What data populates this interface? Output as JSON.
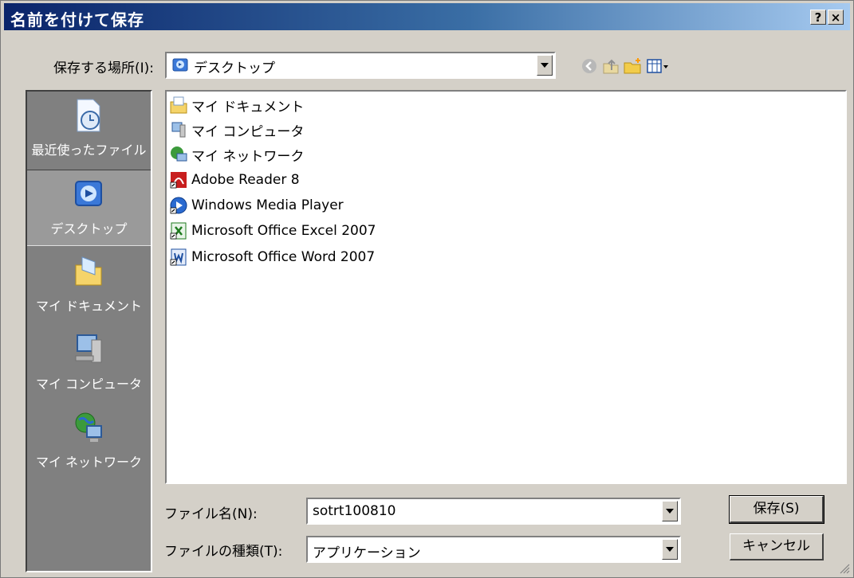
{
  "title": "名前を付けて保存",
  "titlebar_buttons": {
    "help": "?",
    "close": "×"
  },
  "save_in": {
    "label": "保存する場所(I):",
    "value": "デスクトップ"
  },
  "toolbar_icons": [
    "back-icon",
    "up-folder-icon",
    "new-folder-icon",
    "views-menu-icon"
  ],
  "places_bar": [
    {
      "label": "最近使ったファイル",
      "icon": "recent-files-icon",
      "selected": false
    },
    {
      "label": "デスクトップ",
      "icon": "desktop-icon",
      "selected": true
    },
    {
      "label": "マイ ドキュメント",
      "icon": "my-documents-icon",
      "selected": false
    },
    {
      "label": "マイ コンピュータ",
      "icon": "my-computer-icon",
      "selected": false
    },
    {
      "label": "マイ ネットワーク",
      "icon": "my-network-icon",
      "selected": false
    }
  ],
  "file_list": [
    {
      "name": "マイ ドキュメント",
      "icon": "documents-folder-icon"
    },
    {
      "name": "マイ コンピュータ",
      "icon": "computer-icon"
    },
    {
      "name": "マイ ネットワーク",
      "icon": "network-icon"
    },
    {
      "name": "Adobe Reader 8",
      "icon": "pdf-shortcut-icon"
    },
    {
      "name": "Windows Media Player",
      "icon": "media-player-icon"
    },
    {
      "name": "Microsoft Office Excel 2007",
      "icon": "excel-shortcut-icon"
    },
    {
      "name": "Microsoft Office Word 2007",
      "icon": "word-shortcut-icon"
    }
  ],
  "filename": {
    "label": "ファイル名(N):",
    "value": "sotrt100810"
  },
  "filetype": {
    "label": "ファイルの種類(T):",
    "value": "アプリケーション"
  },
  "buttons": {
    "save": "保存(S)",
    "cancel": "キャンセル"
  },
  "colors": {
    "titlebar_start": "#0a246a",
    "titlebar_end": "#a6caf0",
    "dialog_bg": "#d4d0c8",
    "places_bg": "#808080"
  }
}
